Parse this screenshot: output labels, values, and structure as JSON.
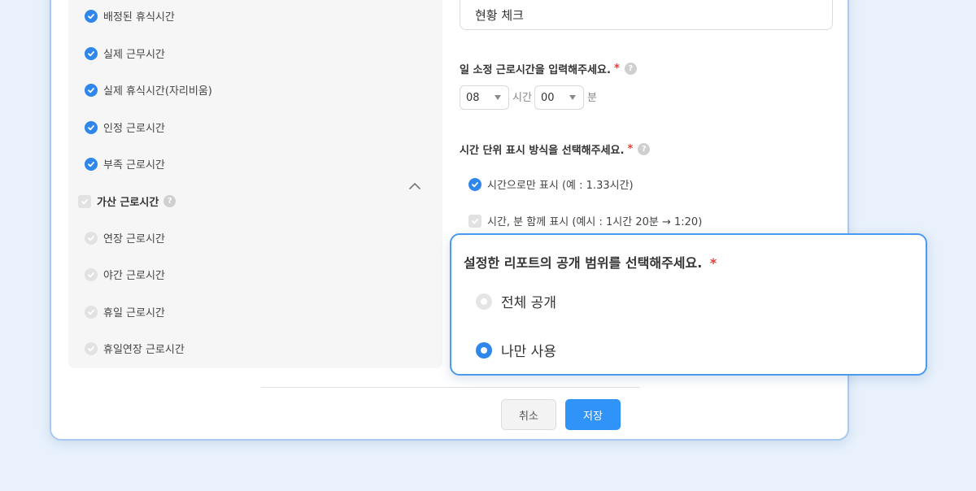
{
  "left_panel": {
    "items": [
      {
        "label": "배정된 휴식시간",
        "checked": true
      },
      {
        "label": "실제 근무시간",
        "checked": true
      },
      {
        "label": "실제 휴식시간(자리비움)",
        "checked": true
      },
      {
        "label": "인정 근로시간",
        "checked": true
      },
      {
        "label": "부족 근로시간",
        "checked": true
      }
    ],
    "group_title": "가산 근로시간",
    "group_items": [
      {
        "label": "연장 근로시간",
        "checked": false
      },
      {
        "label": "야간 근로시간",
        "checked": false
      },
      {
        "label": "휴일 근로시간",
        "checked": false
      },
      {
        "label": "휴일연장 근로시간",
        "checked": false
      }
    ]
  },
  "right_panel": {
    "name_input_value": "현황 체크",
    "hours_label": "일 소정 근로시간을 입력해주세요.",
    "hours_value": "08",
    "hours_unit": "시간",
    "minutes_value": "00",
    "minutes_unit": "분",
    "display_label": "시간 단위 표시 방식을 선택해주세요.",
    "display_options": [
      {
        "label": "시간으로만 표시 (예 : 1.33시간)",
        "checked": true
      },
      {
        "label": "시간, 분 함께 표시 (예시 : 1시간 20분 → 1:20)",
        "checked": false
      }
    ],
    "required_mark": "*",
    "help_glyph": "?"
  },
  "footer": {
    "cancel_label": "취소",
    "save_label": "저장"
  },
  "popup": {
    "title": "설정한 리포트의 공개 범위를 선택해주세요.",
    "required_mark": "*",
    "options": [
      {
        "label": "전체 공개",
        "selected": false
      },
      {
        "label": "나만 사용",
        "selected": true
      }
    ]
  },
  "colors": {
    "accent": "#2f86eb",
    "required": "#e0413a",
    "background": "#e8f1fc"
  }
}
